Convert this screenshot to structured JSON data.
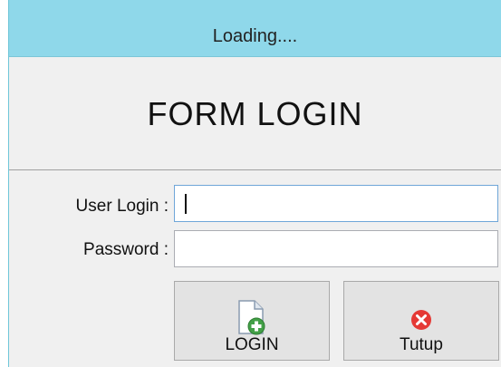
{
  "window": {
    "title": "Loading...."
  },
  "form": {
    "heading": "FORM LOGIN",
    "user_label": "User Login :",
    "user_value": "",
    "password_label": "Password :",
    "password_value": ""
  },
  "buttons": {
    "login": {
      "label": "LOGIN",
      "icon": "document-add-icon"
    },
    "tutup": {
      "label": "Tutup",
      "icon": "close-circle-icon"
    }
  },
  "colors": {
    "titlebar": "#8fd8ea",
    "window_bg": "#f0f0f0",
    "focus_border": "#6fa6d8",
    "close_icon": "#e53935",
    "add_icon": "#43a047"
  }
}
